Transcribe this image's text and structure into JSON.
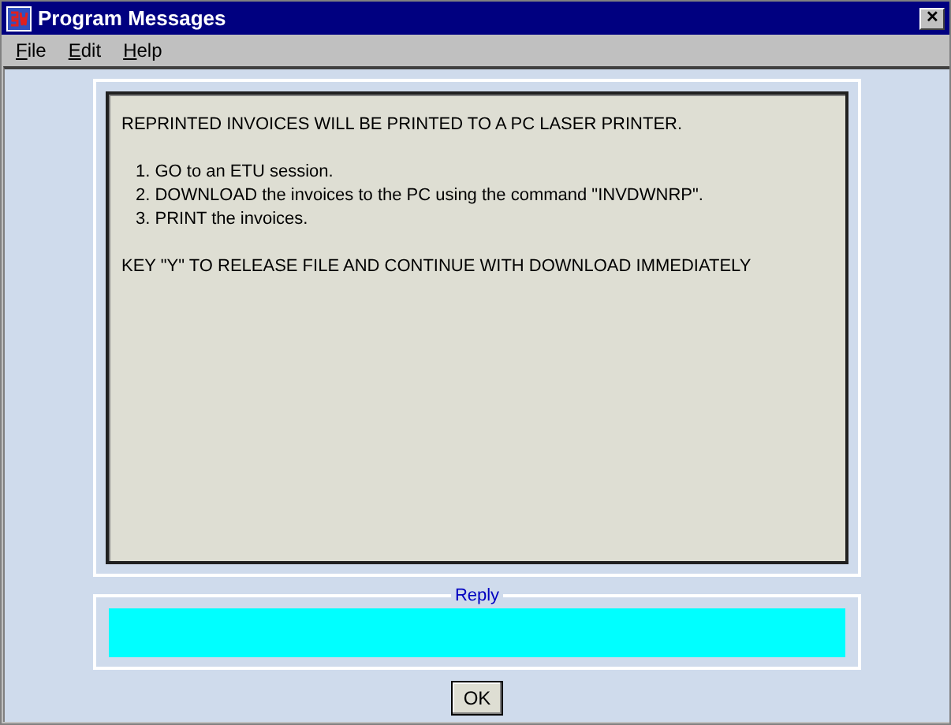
{
  "window": {
    "title": "Program Messages",
    "close": "✕"
  },
  "menu": [
    {
      "label": "File"
    },
    {
      "label": "Edit"
    },
    {
      "label": "Help"
    }
  ],
  "message": {
    "heading": "REPRINTED INVOICES WILL BE PRINTED TO A PC LASER PRINTER.",
    "steps": [
      "1. GO to an ETU session.",
      "2. DOWNLOAD the invoices to the PC using the command \"INVDWNRP\".",
      "3. PRINT the invoices."
    ],
    "footer": "KEY \"Y\" TO RELEASE FILE AND CONTINUE WITH DOWNLOAD IMMEDIATELY"
  },
  "reply": {
    "legend": "Reply"
  },
  "buttons": [
    "OK"
  ]
}
